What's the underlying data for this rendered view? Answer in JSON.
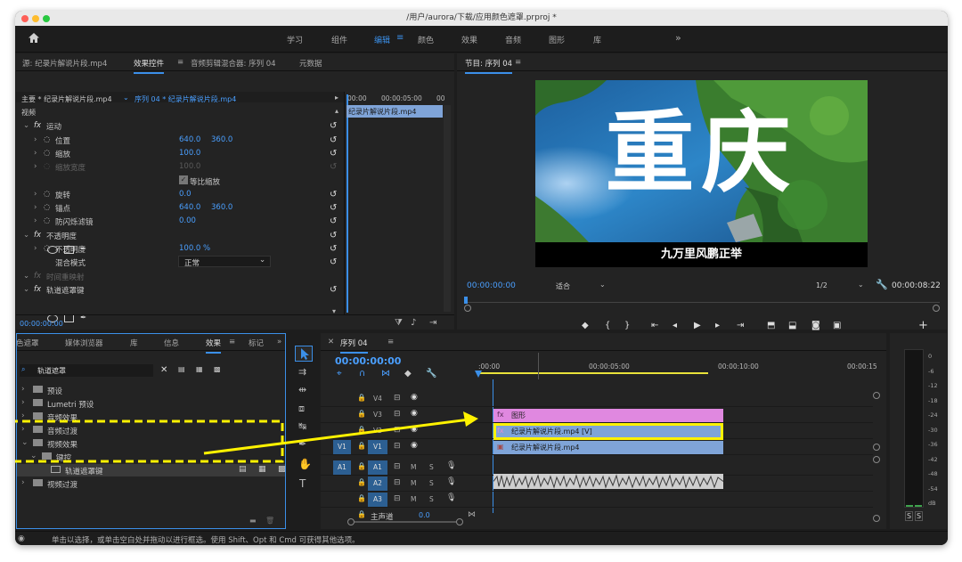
{
  "window": {
    "title": "/用户/aurora/下载/应用颜色遮罩.prproj *"
  },
  "topnav": {
    "tabs": [
      "学习",
      "组件",
      "编辑",
      "颜色",
      "效果",
      "音频",
      "图形",
      "库"
    ],
    "more": "»"
  },
  "effect_controls": {
    "tabs": [
      "源: 纪录片解说片段.mp4",
      "效果控件",
      "音频剪辑混合器: 序列 04",
      "元数据"
    ],
    "master": "主要 * 纪录片解说片段.mp4",
    "sequence": "序列 04 * 纪录片解说片段.mp4",
    "ruler": [
      "00:00",
      "00:00:05:00",
      "00"
    ],
    "clip": "纪录片解说片段.mp4",
    "video_label": "视频",
    "rows": [
      {
        "label": "运动",
        "fx": true
      },
      {
        "label": "位置",
        "v1": "640.0",
        "v2": "360.0"
      },
      {
        "label": "缩放",
        "v1": "100.0"
      },
      {
        "label": "缩放宽度",
        "v1": "100.0",
        "disabled": true
      },
      {
        "label": "等比缩放",
        "checkbox": true
      },
      {
        "label": "旋转",
        "v1": "0.0"
      },
      {
        "label": "锚点",
        "v1": "640.0",
        "v2": "360.0"
      },
      {
        "label": "防闪烁滤镜",
        "v1": "0.00"
      },
      {
        "label": "不透明度",
        "fx": true
      },
      {
        "label": "不透明度",
        "v1": "100.0 %"
      },
      {
        "label": "混合模式",
        "select": "正常"
      },
      {
        "label": "时间重映射",
        "fx": true
      },
      {
        "label": "轨道遮罩键",
        "fx": true
      }
    ],
    "timecode": "00:00:00:00"
  },
  "program": {
    "title": "节目: 序列 04",
    "headline": "重庆",
    "subtitle": "九万里风鹏正举",
    "timecode": "00:00:00:00",
    "fit": "适合",
    "quality": "1/2",
    "duration": "00:00:08:22"
  },
  "effects_panel": {
    "tabs": [
      "色遮罩",
      "媒体浏览器",
      "库",
      "信息",
      "效果",
      "标记"
    ],
    "search": "轨道遮罩",
    "tree": [
      "预设",
      "Lumetri 预设",
      "音频效果",
      "音频过渡",
      "视频效果",
      "键控",
      "轨道遮罩键",
      "视频过渡"
    ]
  },
  "timeline": {
    "title": "序列 04",
    "timecode": "00:00:00:00",
    "ruler": [
      ":00:00",
      "00:00:05:00",
      "00:00:10:00",
      "00:00:15"
    ],
    "tracks": [
      "V4",
      "V3",
      "V2",
      "V1",
      "A1",
      "A2",
      "A3"
    ],
    "source_v": "V1",
    "source_a": "A1",
    "mute": "M",
    "solo": "S",
    "master": "主声道",
    "master_value": "0.0",
    "clips": {
      "graphic": "图形",
      "v2": "纪录片解说片段.mp4 [V]",
      "v1": "纪录片解说片段.mp4"
    }
  },
  "meter": {
    "scale": [
      "0",
      "-6",
      "-12",
      "-18",
      "-24",
      "-30",
      "-36",
      "-42",
      "-48",
      "-54",
      "dB"
    ],
    "solo": [
      "S",
      "S"
    ]
  },
  "status": "单击以选择，或单击空白处并拖动以进行框选。使用 Shift、Opt 和 Cmd 可获得其他选项。",
  "colors": {
    "accent": "#3b8fe8",
    "graphic_clip": "#e088e0",
    "video_clip": "#7fa4d8",
    "highlight": "#fff200"
  }
}
